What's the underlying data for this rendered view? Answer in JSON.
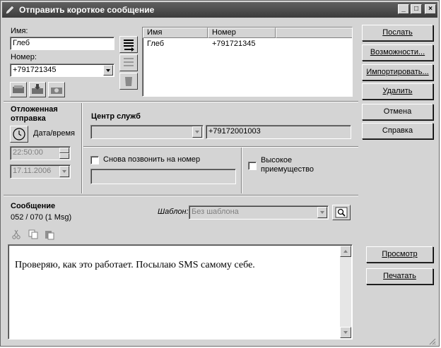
{
  "window": {
    "title": "Отправить короткое сообщение",
    "controls": [
      "_",
      "□",
      "×"
    ]
  },
  "contact": {
    "name_label": "Имя:",
    "name_value": "Глеб",
    "number_label": "Номер:",
    "number_value": "+791721345"
  },
  "recipients": {
    "columns": [
      "Имя",
      "Номер"
    ],
    "rows": [
      {
        "name": "Глеб",
        "number": "+791721345"
      }
    ]
  },
  "deferred": {
    "title_line1": "Отложенная",
    "title_line2": "отправка",
    "datetime_label": "Дата/время",
    "time_value": "22:50:00",
    "date_value": "17.11.2006"
  },
  "service_center": {
    "title": "Центр служб",
    "number_value": "+79172001003",
    "recall_label": "Снова позвонить на номер",
    "high_priority_line1": "Высокое",
    "high_priority_line2": "приемущество"
  },
  "message": {
    "title": "Сообщение",
    "counter": "052 / 070 (1 Msg)",
    "template_label": "Шаблон:",
    "template_value": "Без шаблона",
    "body": "Проверяю, как это работает. Посылаю SMS самому себе."
  },
  "buttons": {
    "send": "Послать",
    "options": "Возможности...",
    "import": "Импортировать...",
    "delete": "Удалить",
    "cancel": "Отмена",
    "help": "Справка",
    "preview": "Просмотр",
    "print": "Печатать"
  },
  "colors": {
    "titlebar": "#4a4a4a",
    "face": "#d4d4d4",
    "window": "#ffffff"
  }
}
